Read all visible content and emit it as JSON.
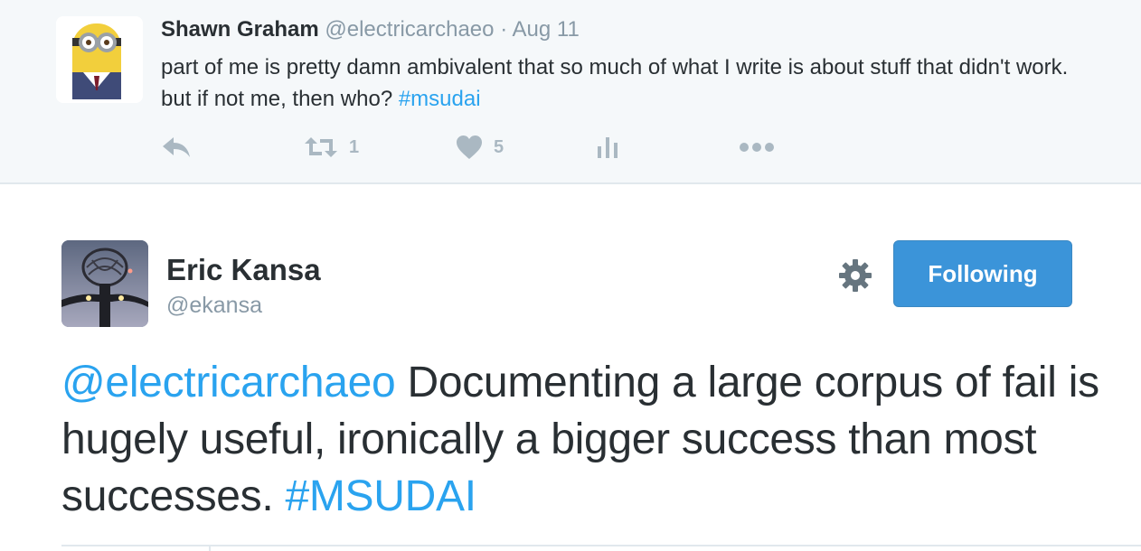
{
  "parent_tweet": {
    "name": "Shawn Graham",
    "handle": "@electricarchaeo",
    "separator": "·",
    "date": "Aug 11",
    "text_main": "part of me is pretty damn ambivalent that so much of what I write is about stuff that didn't work. but if not me, then who? ",
    "hashtag": "#msudai",
    "avatar_icon": "minion-avatar-icon",
    "actions": {
      "reply_icon": "reply-icon",
      "retweet_icon": "retweet-icon",
      "retweet_count": "1",
      "like_icon": "heart-icon",
      "like_count": "5",
      "analytics_icon": "analytics-icon",
      "more_icon": "more-dots-icon"
    }
  },
  "main_tweet": {
    "name": "Eric Kansa",
    "handle": "@ekansa",
    "avatar_icon": "figure-avatar-icon",
    "settings_icon": "gear-icon",
    "follow_label": "Following",
    "mention": "@electricarchaeo",
    "text_main": " Documenting a large corpus of fail is hugely useful, ironically a bigger success than most successes. ",
    "hashtag": "#MSUDAI"
  },
  "colors": {
    "link": "#2aa3ef",
    "follow_button": "#3b94d9",
    "muted": "#8899a6",
    "action_icon": "#aab8c2",
    "parent_background": "#f5f8fa"
  }
}
